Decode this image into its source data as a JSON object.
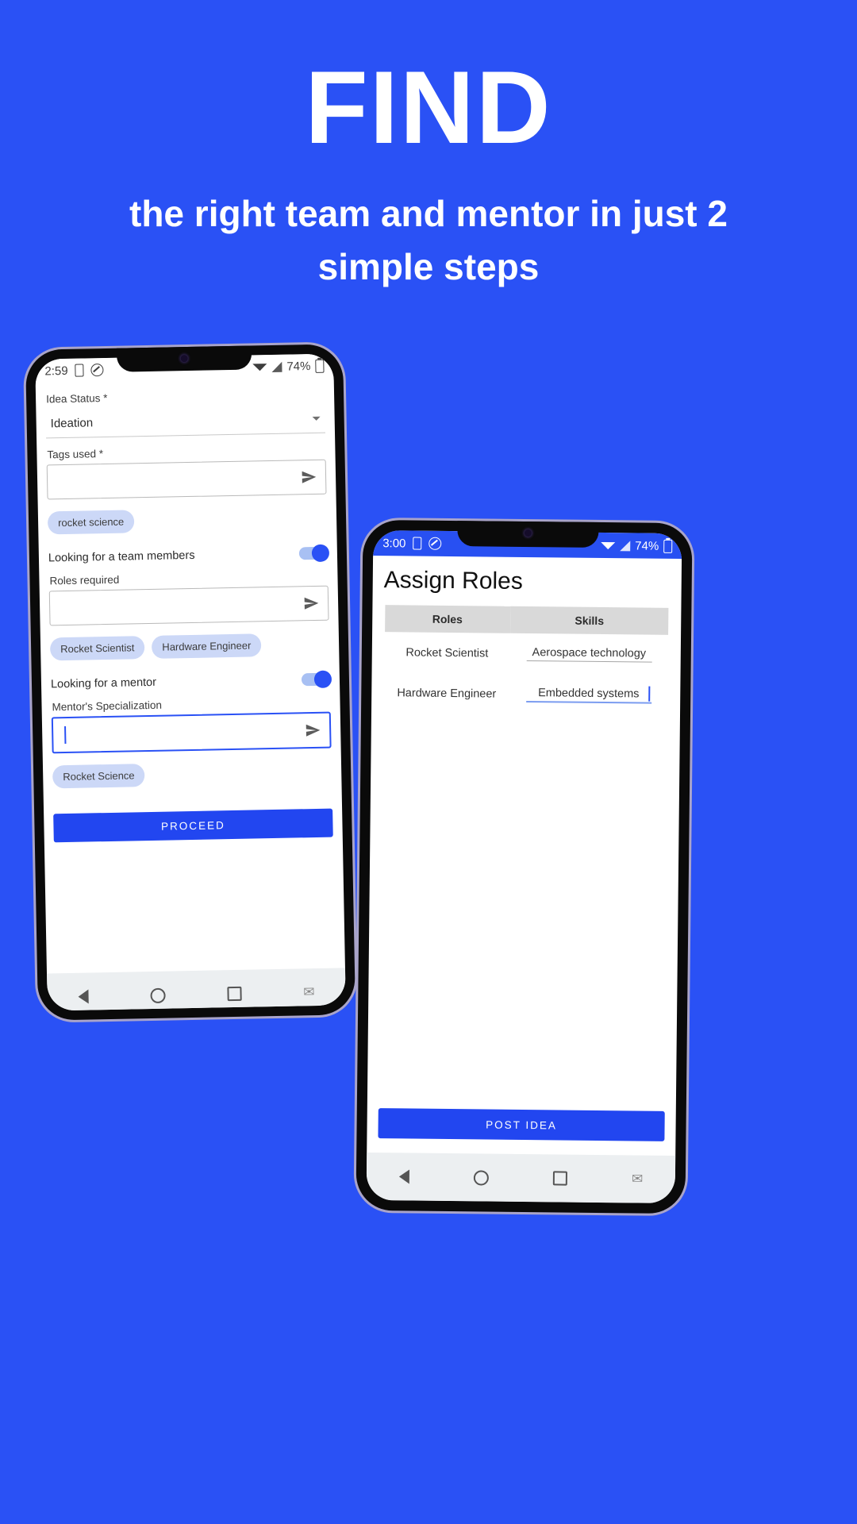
{
  "hero": {
    "title": "FIND",
    "subtitle": "the right team and mentor in just 2 simple steps"
  },
  "colors": {
    "background": "#2a51f5",
    "accent": "#2246f0",
    "chip_bg": "#ccd8f7",
    "table_header_bg": "#d9d9d9"
  },
  "left_phone": {
    "status_bar": {
      "time": "2:59",
      "battery": "74%",
      "icons": [
        "phone-icon",
        "dnd-icon",
        "wifi-icon",
        "signal-icon",
        "battery-icon"
      ]
    },
    "form": {
      "idea_status_label": "Idea Status *",
      "idea_status_value": "Ideation",
      "tags_label": "Tags used *",
      "tags_input_value": "",
      "tags_chips": [
        "rocket science"
      ],
      "team_toggle_label": "Looking for a team members",
      "team_toggle_state": "on",
      "roles_label": "Roles required",
      "roles_input_value": "",
      "roles_chips": [
        "Rocket Scientist",
        "Hardware Engineer"
      ],
      "mentor_toggle_label": "Looking for a mentor",
      "mentor_toggle_state": "on",
      "mentor_label": "Mentor's Specialization",
      "mentor_input_value": "",
      "mentor_chips": [
        "Rocket Science"
      ],
      "proceed_button": "PROCEED"
    },
    "nav_bar": {
      "back": "back-icon",
      "home": "home-icon",
      "recents": "recents-icon",
      "accessibility": "accessibility-icon"
    }
  },
  "right_phone": {
    "status_bar": {
      "time": "3:00",
      "battery": "74%",
      "icons": [
        "phone-icon",
        "dnd-icon",
        "wifi-icon",
        "signal-icon",
        "battery-icon"
      ]
    },
    "screen_title": "Assign Roles",
    "table": {
      "headers": [
        "Roles",
        "Skills"
      ],
      "rows": [
        {
          "role": "Rocket Scientist",
          "skill": "Aerospace technology",
          "focused": false
        },
        {
          "role": "Hardware Engineer",
          "skill": "Embedded systems",
          "focused": true
        }
      ]
    },
    "post_button": "POST IDEA",
    "nav_bar": {
      "back": "back-icon",
      "home": "home-icon",
      "recents": "recents-icon",
      "accessibility": "accessibility-icon"
    }
  }
}
